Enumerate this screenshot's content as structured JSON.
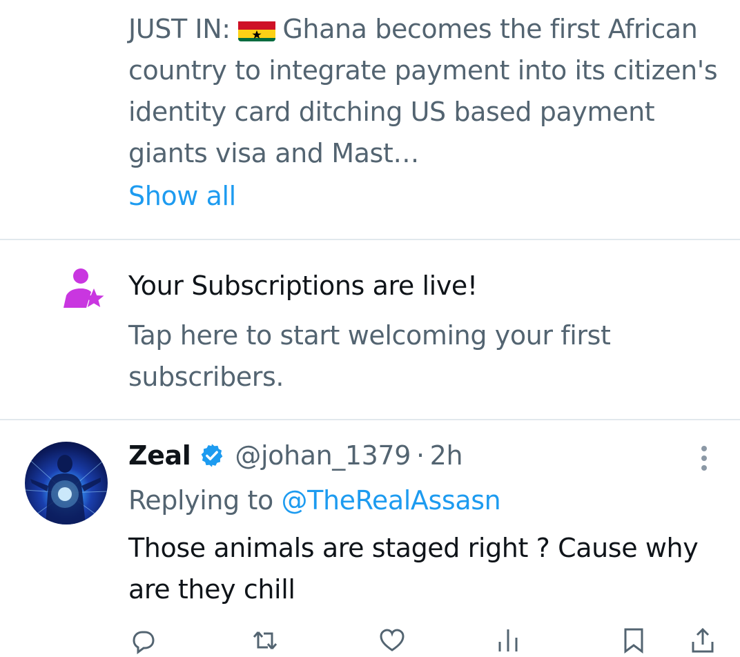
{
  "quoted_post": {
    "text_prefix": "JUST IN:",
    "text_body": "Ghana becomes the first African country to integrate payment into its citizen's identity card ditching US based payment giants visa and Mast…",
    "show_all_label": "Show all",
    "flag_icon": "ghana-flag-icon"
  },
  "subscriptions_prompt": {
    "title": "Your Subscriptions are live!",
    "body": "Tap here to start welcoming your first subscribers.",
    "icon": "person-star-icon",
    "icon_color": "#c936e0"
  },
  "reply_post": {
    "author_name": "Zeal",
    "verified_icon": "verified-badge-icon",
    "handle": "@johan_1379",
    "separator": "·",
    "time": "2h",
    "replying_prefix": "Replying to",
    "replying_to": "@TheRealAssasn",
    "text": "Those animals are staged right ? Cause why are they chill"
  },
  "actions": [
    {
      "name": "reply-icon"
    },
    {
      "name": "repost-icon"
    },
    {
      "name": "like-icon"
    },
    {
      "name": "views-icon"
    },
    {
      "name": "bookmark-icon"
    },
    {
      "name": "share-icon"
    }
  ],
  "colors": {
    "accent": "#1d9bf0",
    "secondary_text": "#536471",
    "primary_text": "#0f1419",
    "divider": "#e1e8ed"
  }
}
